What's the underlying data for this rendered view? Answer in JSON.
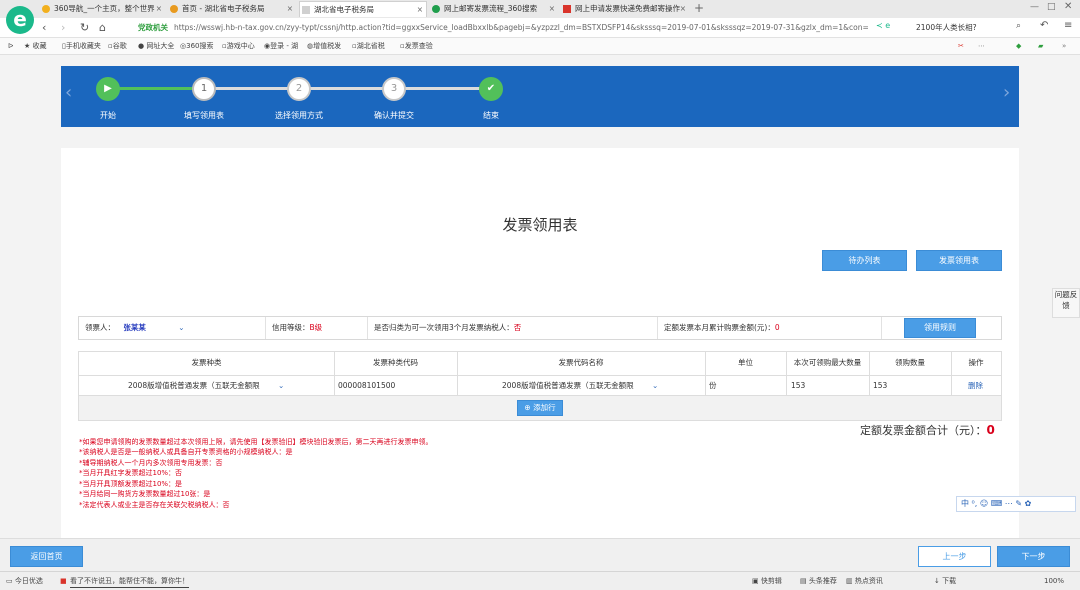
{
  "browser": {
    "tabs": [
      {
        "label": "360导航_一个主页，整个世界"
      },
      {
        "label": "首页 - 湖北省电子税务局"
      },
      {
        "label": "湖北省电子税务局"
      },
      {
        "label": "网上邮寄发票流程_360搜索"
      },
      {
        "label": "网上申请发票快递免费邮寄操作"
      }
    ],
    "new_tab": "+",
    "security_label": "党政机关",
    "url": "https://wsswj.hb-n-tax.gov.cn/zyy-typt/cssnj/http.action?tid=ggxxService_loadBbxxlb&pagebj=&yzpzzl_dm=BSTXDSFP14&sksssq=2019-07-01&sksssqz=2019-07-31&gzlx_dm=1&con=",
    "search_text": "2100年人类长相?",
    "bookmarks": [
      "收藏",
      "手机收藏夹",
      "谷歌",
      "网址大全",
      "360搜索",
      "游戏中心",
      "登录 - 湖",
      "增值税发",
      "湖北省税",
      "发票查验"
    ]
  },
  "steps": [
    {
      "label": "开始",
      "symbol": "▶",
      "state": "done"
    },
    {
      "label": "填写领用表",
      "symbol": "1",
      "state": "current"
    },
    {
      "label": "选择领用方式",
      "symbol": "2",
      "state": "todo"
    },
    {
      "label": "确认并提交",
      "symbol": "3",
      "state": "todo"
    },
    {
      "label": "结束",
      "symbol": "✔",
      "state": "done"
    }
  ],
  "page": {
    "title": "发票领用表",
    "btn_list": "待办列表",
    "btn_form": "发票领用表"
  },
  "info": {
    "receiver_label": "领票人：",
    "receiver_value": "张某某",
    "credit_label": "信用等级：",
    "credit_value": "B级",
    "first_time_label": "是否归类为可一次领用3个月发票纳税人：",
    "first_time_value": "否",
    "fixed_amount_label": "定额发票本月累计购票金额(元)：",
    "fixed_amount_value": "0",
    "rules_btn": "领用规则"
  },
  "table": {
    "headers": [
      "发票种类",
      "发票种类代码",
      "发票代码名称",
      "单位",
      "本次可领购最大数量",
      "领购数量",
      "操作"
    ],
    "rows": [
      {
        "type": "2008版增值税普通发票（五联无金额限",
        "code": "000008101500",
        "name": "2008版增值税普通发票（五联无金额限",
        "unit": "份",
        "max": "153",
        "qty": "153",
        "action": "删除"
      }
    ],
    "add_row": "添加行"
  },
  "total": {
    "label": "定额发票金额合计（元）：",
    "value": "0"
  },
  "notes": [
    "*如果您申请领购的发票数量超过本次领用上限，请先使用【发票验旧】模块验旧发票后，第二天再进行发票申领。",
    "*该纳税人是否是一般纳税人或具备自开专票资格的小规模纳税人：是",
    "*辅导期纳税人一个月内多次领用专用发票：否",
    "*当月开具红字发票超过10%：否",
    "*当月开具顶额发票超过10%：是",
    "*当月给同一购货方发票数量超过10张：是",
    "*法定代表人或业主是否存在关联欠税纳税人：否"
  ],
  "footer": {
    "home": "返回首页",
    "prev": "上一步",
    "next": "下一步"
  },
  "side": {
    "feedback": "问题反馈"
  },
  "ime": "中 ⁰, ☺ ⌨ ⋯ ✎ ✿",
  "status": {
    "left": "今日优选",
    "news": "看了不许说丑，能帮住不能，算你牛！",
    "items": [
      "快剪辑",
      "头条推荐",
      "热点资讯",
      "下载",
      "100%"
    ]
  }
}
